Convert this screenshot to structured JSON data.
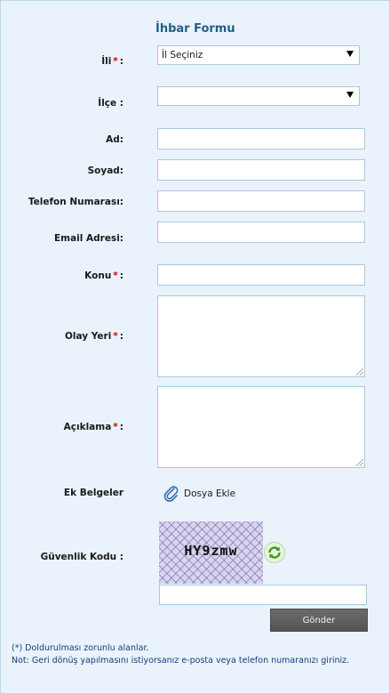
{
  "form": {
    "title": "İhbar Formu",
    "labels": {
      "il": "İli",
      "ilce": "İlçe :",
      "ad": "Ad:",
      "soyad": "Soyad:",
      "telefon": "Telefon Numarası:",
      "email": "Email Adresi:",
      "konu": "Konu",
      "olay_yeri": "Olay Yeri",
      "aciklama": "Açıklama",
      "ek_belgeler": "Ek Belgeler",
      "guvenlik_kodu": "Güvenlik Kodu :"
    },
    "required_mark": "*",
    "colon": ":",
    "il_select_value": "İl Seçiniz",
    "ilce_select_value": "",
    "attach_label": "Dosya Ekle",
    "captcha_text": "HY9zmw",
    "submit_label": "Gönder",
    "notes": {
      "required": "(*) Doldurulması zorunlu alanlar.",
      "contact": "Not: Geri dönüş yapılmasını istiyorsanız e-posta veya telefon numaranızı giriniz."
    }
  },
  "colors": {
    "background": "#eaf2fb",
    "title": "#1f5f86",
    "required": "#d40000",
    "field_border": "#a9c9df",
    "button": "#5f5f5f",
    "note": "#12407a"
  },
  "icons": {
    "attach": "paperclip-icon",
    "refresh": "refresh-icon",
    "select_arrow": "dropdown-arrow-icon"
  }
}
